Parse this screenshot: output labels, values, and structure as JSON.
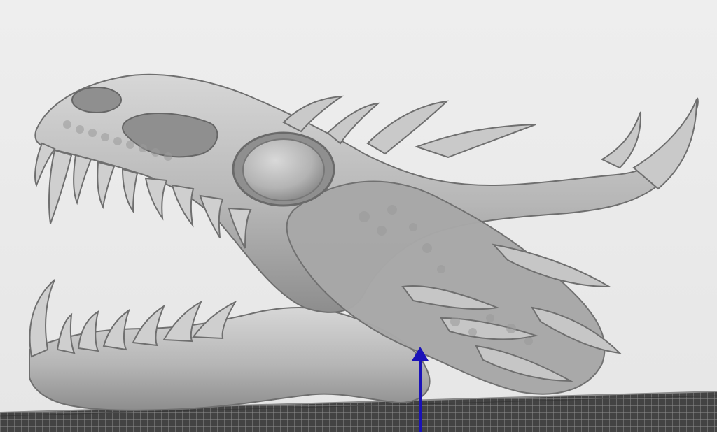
{
  "viewport": {
    "background": "#e9e9e9",
    "model": {
      "name": "dragon-skull",
      "color": "#a7a7a7",
      "highlight": "#d6d6d6",
      "shadow": "#6f6f6f"
    },
    "build_plate": {
      "grid_color": "#6f6f6f",
      "plate_color": "#3b3b3b"
    },
    "axis_indicator": {
      "color": "#1a12b8",
      "icon": "z-axis-arrow"
    }
  }
}
